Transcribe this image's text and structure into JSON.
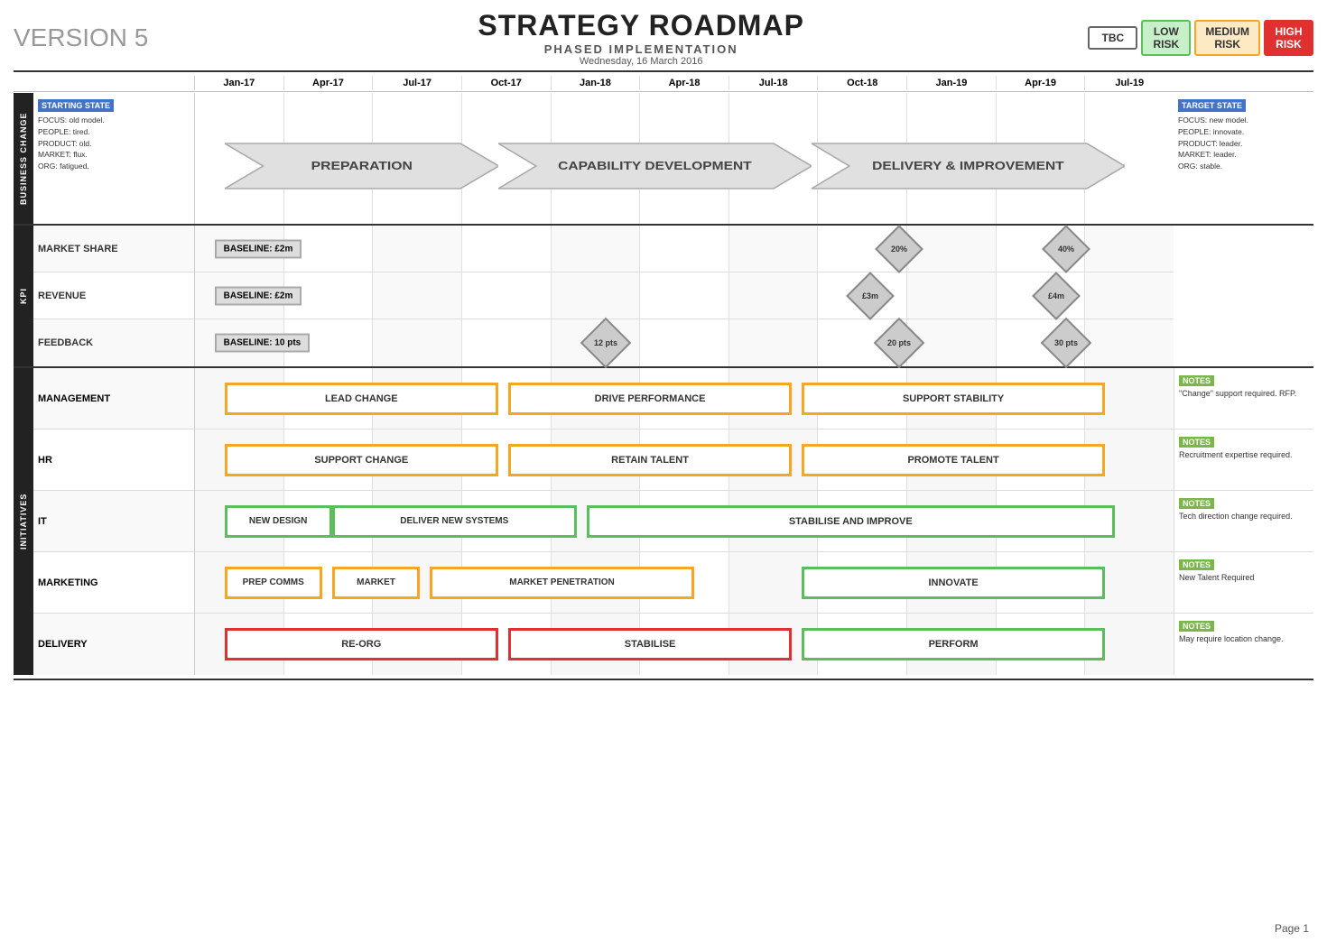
{
  "header": {
    "version": "VERSION 5",
    "title": "STRATEGY ROADMAP",
    "subtitle": "PHASED IMPLEMENTATION",
    "date": "Wednesday, 16 March 2016",
    "risk_badges": [
      {
        "label": "TBC",
        "class": "risk-tbc"
      },
      {
        "label": "LOW\nRISK",
        "class": "risk-low"
      },
      {
        "label": "MEDIUM\nRISK",
        "class": "risk-medium"
      },
      {
        "label": "HIGH\nRISK",
        "class": "risk-high"
      }
    ]
  },
  "timeline": {
    "columns": [
      "Jan-17",
      "Apr-17",
      "Jul-17",
      "Oct-17",
      "Jan-18",
      "Apr-18",
      "Jul-18",
      "Oct-18",
      "Jan-19",
      "Apr-19",
      "Jul-19"
    ]
  },
  "sections": {
    "business_change": {
      "tab": "BUSINESS CHANGE",
      "starting_state": {
        "label": "STARTING STATE",
        "lines": [
          "FOCUS: old model.",
          "PEOPLE: tired.",
          "PRODUCT: old.",
          "MARKET: flux.",
          "ORG: fatigued."
        ]
      },
      "target_state": {
        "label": "TARGET STATE",
        "lines": [
          "FOCUS: new model.",
          "PEOPLE: innovate.",
          "PRODUCT: leader.",
          "MARKET: leader.",
          "ORG: stable."
        ]
      },
      "phases": [
        {
          "label": "PREPARATION",
          "start_pct": 5,
          "width_pct": 28
        },
        {
          "label": "CAPABILITY DEVELOPMENT",
          "start_pct": 33,
          "width_pct": 30
        },
        {
          "label": "DELIVERY & IMPROVEMENT",
          "start_pct": 63,
          "width_pct": 30
        }
      ]
    },
    "kpi": {
      "tab": "KPI",
      "rows": [
        {
          "label": "MARKET SHARE",
          "baseline": "BASELINE: £2m",
          "milestones": [
            {
              "label": "20%",
              "col_pct": 73,
              "type": "diamond"
            },
            {
              "label": "40%",
              "col_pct": 90,
              "type": "diamond"
            }
          ]
        },
        {
          "label": "REVENUE",
          "baseline": "BASELINE: £2m",
          "milestones": [
            {
              "label": "£3m",
              "col_pct": 70,
              "type": "diamond"
            },
            {
              "label": "£4m",
              "col_pct": 89,
              "type": "diamond"
            }
          ]
        },
        {
          "label": "FEEDBACK",
          "baseline": "BASELINE: 10 pts",
          "milestones": [
            {
              "label": "12 pts",
              "col_pct": 43,
              "type": "diamond"
            },
            {
              "label": "20 pts",
              "col_pct": 73,
              "type": "diamond"
            },
            {
              "label": "30 pts",
              "col_pct": 90,
              "type": "diamond"
            }
          ]
        }
      ]
    },
    "initiatives": {
      "tab": "INITIATIVES",
      "rows": [
        {
          "label": "MANAGEMENT",
          "boxes": [
            {
              "label": "LEAD CHANGE",
              "start_pct": 5,
              "width_pct": 27,
              "color": "orange"
            },
            {
              "label": "DRIVE PERFORMANCE",
              "start_pct": 32,
              "width_pct": 28,
              "color": "orange"
            },
            {
              "label": "SUPPORT STABILITY",
              "start_pct": 62,
              "width_pct": 30,
              "color": "orange"
            }
          ],
          "note_label": "NOTES",
          "note_text": "\"Change\" support required. RFP."
        },
        {
          "label": "HR",
          "boxes": [
            {
              "label": "SUPPORT CHANGE",
              "start_pct": 5,
              "width_pct": 27,
              "color": "orange"
            },
            {
              "label": "RETAIN TALENT",
              "start_pct": 32,
              "width_pct": 28,
              "color": "orange"
            },
            {
              "label": "PROMOTE TALENT",
              "start_pct": 62,
              "width_pct": 30,
              "color": "orange"
            }
          ],
          "note_label": "NOTES",
          "note_text": "Recruitment expertise required."
        },
        {
          "label": "IT",
          "boxes": [
            {
              "label": "NEW DESIGN",
              "start_pct": 5,
              "width_pct": 12,
              "color": "green"
            },
            {
              "label": "DELIVER NEW SYSTEMS",
              "start_pct": 17,
              "width_pct": 23,
              "color": "green"
            },
            {
              "label": "STABILISE AND IMPROVE",
              "start_pct": 41,
              "width_pct": 51,
              "color": "green"
            }
          ],
          "note_label": "NOTES",
          "note_text": "Tech direction change required."
        },
        {
          "label": "MARKETING",
          "boxes": [
            {
              "label": "PREP COMMS",
              "start_pct": 5,
              "width_pct": 10,
              "color": "orange"
            },
            {
              "label": "MARKET",
              "start_pct": 15,
              "width_pct": 9,
              "color": "orange"
            },
            {
              "label": "MARKET PENETRATION",
              "start_pct": 27,
              "width_pct": 27,
              "color": "orange"
            },
            {
              "label": "INNOVATE",
              "start_pct": 62,
              "width_pct": 30,
              "color": "green"
            }
          ],
          "note_label": "NOTES",
          "note_text": "New Talent Required"
        },
        {
          "label": "DELIVERY",
          "boxes": [
            {
              "label": "RE-ORG",
              "start_pct": 5,
              "width_pct": 27,
              "color": "red"
            },
            {
              "label": "STABILISE",
              "start_pct": 32,
              "width_pct": 28,
              "color": "red"
            },
            {
              "label": "PERFORM",
              "start_pct": 62,
              "width_pct": 30,
              "color": "green"
            }
          ],
          "note_label": "NOTES",
          "note_text": "May require location change."
        }
      ]
    }
  },
  "page": {
    "number": "Page 1"
  }
}
